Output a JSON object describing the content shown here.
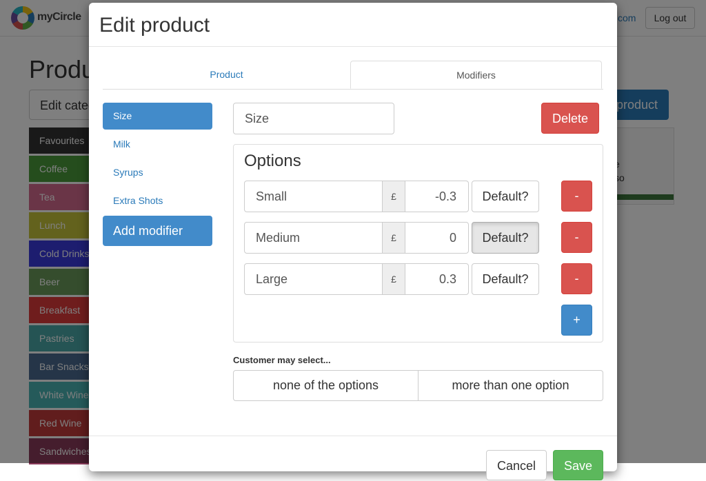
{
  "app": {
    "brand": "myCircle",
    "user_email_fragment": "com",
    "logout_label": "Log out"
  },
  "background": {
    "heading": "Produ",
    "edit_category_label": "Edit categ",
    "add_product_label": "product",
    "product_card_text": [
      "e",
      "so"
    ],
    "categories": [
      {
        "label": "Favourites",
        "color": "#333333"
      },
      {
        "label": "Coffee",
        "color": "#4a9a3a"
      },
      {
        "label": "Tea",
        "color": "#d46a8f"
      },
      {
        "label": "Lunch",
        "color": "#c7c43a"
      },
      {
        "label": "Cold Drinks",
        "color": "#3a3adf"
      },
      {
        "label": "Beer",
        "color": "#6a9a5a"
      },
      {
        "label": "Breakfast",
        "color": "#df3a3a"
      },
      {
        "label": "Pastries",
        "color": "#4aa8a8"
      },
      {
        "label": "Bar Snacks",
        "color": "#4a6a90"
      },
      {
        "label": "White Wine",
        "color": "#4ab4b4"
      },
      {
        "label": "Red Wine",
        "color": "#c23a3a"
      },
      {
        "label": "Sandwiches",
        "color": "#8a3a5a"
      }
    ]
  },
  "modal": {
    "title": "Edit product",
    "tabs": [
      {
        "label": "Product",
        "active": false
      },
      {
        "label": "Modifiers",
        "active": true
      }
    ],
    "modifiers": [
      {
        "label": "Size",
        "active": true
      },
      {
        "label": "Milk",
        "active": false
      },
      {
        "label": "Syrups",
        "active": false
      },
      {
        "label": "Extra Shots",
        "active": false
      }
    ],
    "add_modifier_label": "Add modifier",
    "modifier_name_value": "Size",
    "delete_label": "Delete",
    "options_title": "Options",
    "options": [
      {
        "name": "Small",
        "currency": "£",
        "price": "-0.3",
        "default_label": "Default?",
        "default_active": false,
        "remove_label": "-"
      },
      {
        "name": "Medium",
        "currency": "£",
        "price": "0",
        "default_label": "Default?",
        "default_active": true,
        "remove_label": "-"
      },
      {
        "name": "Large",
        "currency": "£",
        "price": "0.3",
        "default_label": "Default?",
        "default_active": false,
        "remove_label": "-"
      }
    ],
    "add_option_label": "+",
    "customer_select_label": "Customer may select...",
    "select_none_label": "none of the options",
    "select_many_label": "more than one option",
    "cancel_label": "Cancel",
    "save_label": "Save"
  }
}
